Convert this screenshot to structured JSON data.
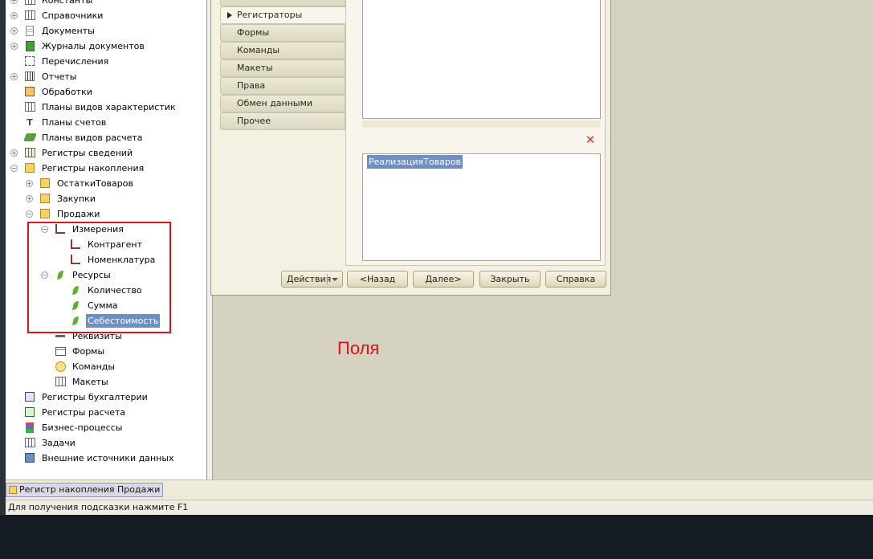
{
  "tree": {
    "items": [
      {
        "label": "Константы",
        "icon": "constants-icon"
      },
      {
        "label": "Справочники",
        "icon": "catalogs-icon"
      },
      {
        "label": "Документы",
        "icon": "documents-icon"
      },
      {
        "label": "Журналы документов",
        "icon": "document-journals-icon"
      },
      {
        "label": "Перечисления",
        "icon": "enumerations-icon"
      },
      {
        "label": "Отчеты",
        "icon": "reports-icon"
      },
      {
        "label": "Обработки",
        "icon": "data-processors-icon"
      },
      {
        "label": "Планы видов характеристик",
        "icon": "characteristic-types-icon"
      },
      {
        "label": "Планы счетов",
        "icon": "charts-of-accounts-icon"
      },
      {
        "label": "Планы видов расчета",
        "icon": "calculation-types-icon"
      },
      {
        "label": "Регистры сведений",
        "icon": "information-registers-icon"
      },
      {
        "label": "Регистры накопления",
        "icon": "accumulation-registers-icon"
      },
      {
        "label": "ОстаткиТоваров",
        "icon": "register-icon"
      },
      {
        "label": "Закупки",
        "icon": "register-icon"
      },
      {
        "label": "Продажи",
        "icon": "register-icon"
      },
      {
        "label": "Измерения",
        "icon": "dimensions-icon"
      },
      {
        "label": "Контрагент",
        "icon": "dimension-icon"
      },
      {
        "label": "Номенклатура",
        "icon": "dimension-icon"
      },
      {
        "label": "Ресурсы",
        "icon": "resources-icon"
      },
      {
        "label": "Количество",
        "icon": "resource-icon"
      },
      {
        "label": "Сумма",
        "icon": "resource-icon"
      },
      {
        "label": "Себестоимость",
        "icon": "resource-icon"
      },
      {
        "label": "Реквизиты",
        "icon": "attributes-icon"
      },
      {
        "label": "Формы",
        "icon": "forms-icon"
      },
      {
        "label": "Команды",
        "icon": "commands-icon"
      },
      {
        "label": "Макеты",
        "icon": "templates-icon"
      },
      {
        "label": "Регистры бухгалтерии",
        "icon": "accounting-registers-icon"
      },
      {
        "label": "Регистры расчета",
        "icon": "calculation-registers-icon"
      },
      {
        "label": "Бизнес-процессы",
        "icon": "business-processes-icon"
      },
      {
        "label": "Задачи",
        "icon": "tasks-icon"
      },
      {
        "label": "Внешние источники данных",
        "icon": "external-data-sources-icon"
      }
    ],
    "selected": "Себестоимость"
  },
  "wizard": {
    "tabs": [
      {
        "label": "Регистраторы",
        "active": true
      },
      {
        "label": "Формы",
        "active": false
      },
      {
        "label": "Команды",
        "active": false
      },
      {
        "label": "Макеты",
        "active": false
      },
      {
        "label": "Права",
        "active": false
      },
      {
        "label": "Обмен данными",
        "active": false
      },
      {
        "label": "Прочее",
        "active": false
      }
    ],
    "lower_list_item": "РеализацияТоваров",
    "buttons": {
      "actions": "Действия",
      "back": "<Назад",
      "next": "Далее>",
      "close": "Закрыть",
      "help": "Справка"
    }
  },
  "annotation": "Поля",
  "window_tab": "Регистр накопления Продажи",
  "status_bar": "Для получения подсказки нажмите F1",
  "colors": {
    "highlight": "#e1101d",
    "selection": "#6d8fc6"
  }
}
